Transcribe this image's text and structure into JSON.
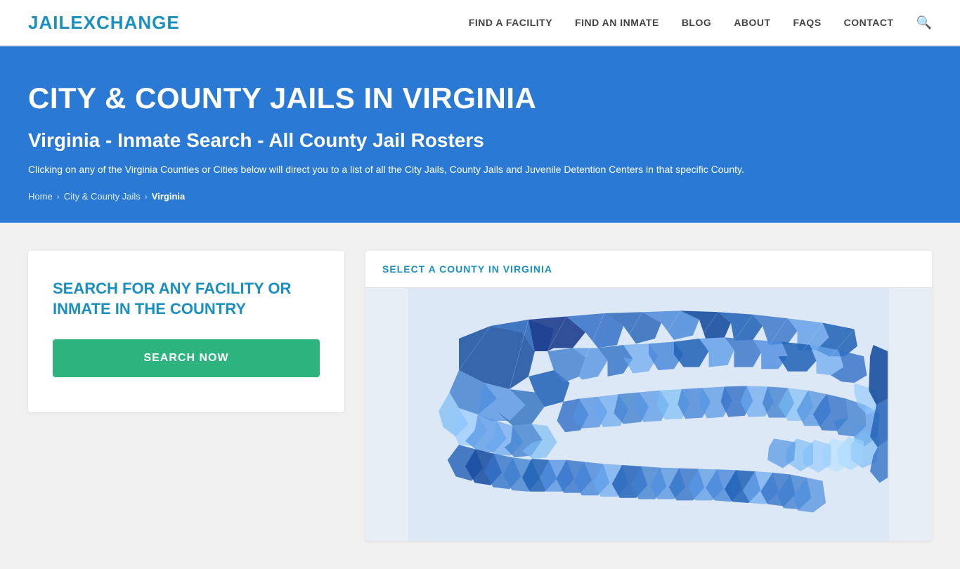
{
  "header": {
    "logo_text_black": "JAIL",
    "logo_text_blue": "EXCHANGE",
    "nav": [
      {
        "id": "find-facility",
        "label": "FIND A FACILITY"
      },
      {
        "id": "find-inmate",
        "label": "FIND AN INMATE"
      },
      {
        "id": "blog",
        "label": "BLOG"
      },
      {
        "id": "about",
        "label": "ABOUT"
      },
      {
        "id": "faqs",
        "label": "FAQs"
      },
      {
        "id": "contact",
        "label": "CONTACT"
      }
    ]
  },
  "hero": {
    "title": "CITY & COUNTY JAILS IN VIRGINIA",
    "subtitle": "Virginia - Inmate Search - All County Jail Rosters",
    "description": "Clicking on any of the Virginia Counties or Cities below will direct you to a list of all the City Jails, County Jails and Juvenile Detention Centers in that specific County.",
    "breadcrumb": {
      "home": "Home",
      "parent": "City & County Jails",
      "current": "Virginia"
    }
  },
  "search_card": {
    "heading": "SEARCH FOR ANY FACILITY OR INMATE IN THE COUNTRY",
    "button_label": "SEARCH NOW"
  },
  "county_panel": {
    "heading": "SELECT A COUNTY IN VIRGINIA"
  }
}
